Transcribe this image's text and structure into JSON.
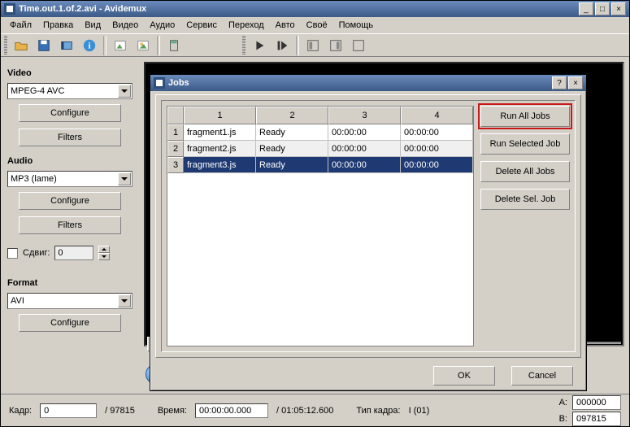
{
  "window": {
    "title": "Time.out.1.of.2.avi - Avidemux"
  },
  "menu": [
    "Файл",
    "Правка",
    "Вид",
    "Видео",
    "Аудио",
    "Сервис",
    "Переход",
    "Авто",
    "Своё",
    "Помощь"
  ],
  "left": {
    "video_label": "Video",
    "video_codec": "MPEG-4 AVC",
    "configure": "Configure",
    "filters": "Filters",
    "audio_label": "Audio",
    "audio_codec": "MP3 (lame)",
    "shift_label": "Сдвиг:",
    "shift_value": "0",
    "format_label": "Format",
    "format_value": "AVI"
  },
  "status": {
    "frame_label": "Кадр:",
    "frame_cur": "0",
    "frame_total": "/ 97815",
    "time_label": "Время:",
    "time_cur": "00:00:00.000",
    "time_total": "/ 01:05:12.600",
    "frametype_label": "Тип кадра:",
    "frametype_value": "I (01)",
    "a_label": "A:",
    "a_value": "000000",
    "b_label": "B:",
    "b_value": "097815"
  },
  "dialog": {
    "title": "Jobs",
    "columns": [
      "1",
      "2",
      "3",
      "4"
    ],
    "rows": [
      {
        "n": "1",
        "cells": [
          "fragment1.js",
          "Ready",
          "00:00:00",
          "00:00:00"
        ]
      },
      {
        "n": "2",
        "cells": [
          "fragment2.js",
          "Ready",
          "00:00:00",
          "00:00:00"
        ]
      },
      {
        "n": "3",
        "cells": [
          "fragment3.js",
          "Ready",
          "00:00:00",
          "00:00:00"
        ]
      }
    ],
    "side": {
      "run_all": "Run All Jobs",
      "run_sel": "Run Selected Job",
      "del_all": "Delete All Jobs",
      "del_sel": "Delete Sel. Job"
    },
    "ok": "OK",
    "cancel": "Cancel"
  }
}
